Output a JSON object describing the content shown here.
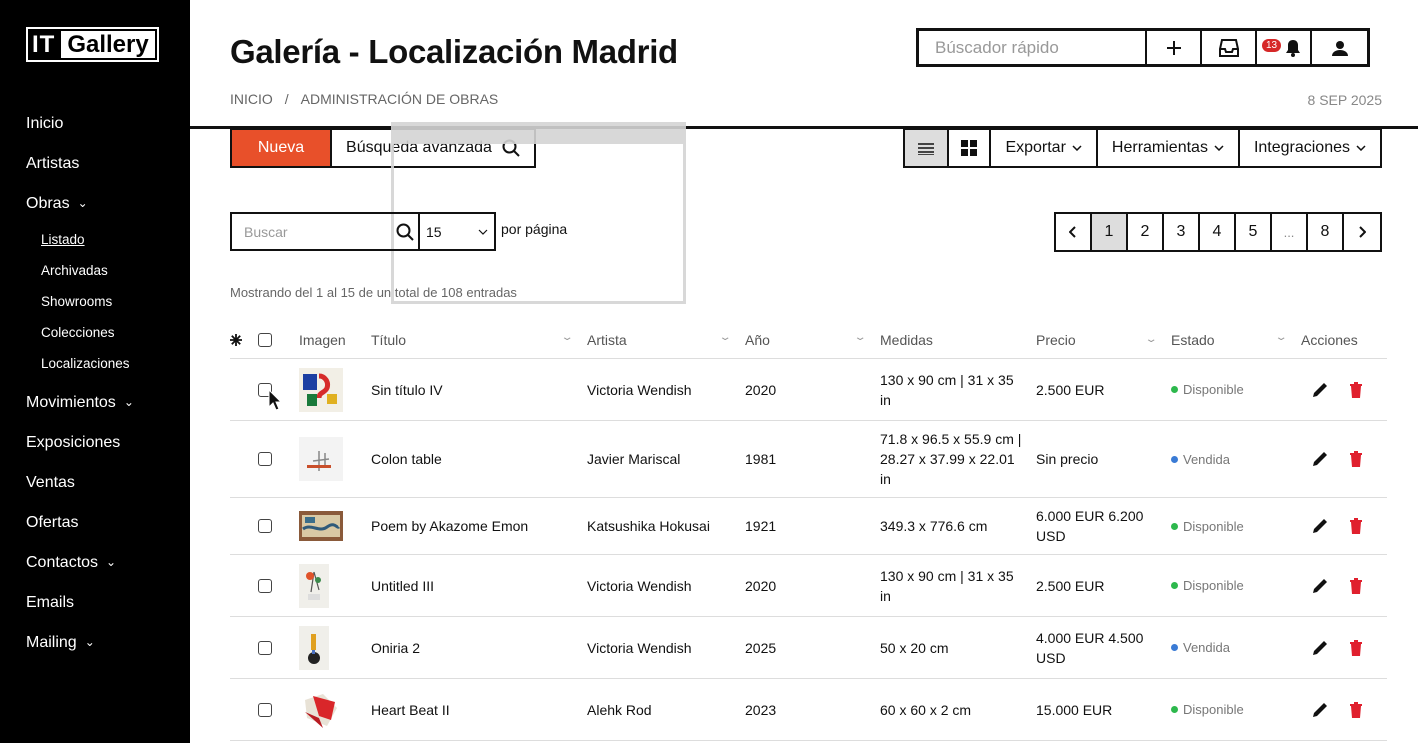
{
  "app": {
    "logo_it": "IT",
    "logo_gallery": "Gallery"
  },
  "sidebar": {
    "items": [
      {
        "label": "Inicio"
      },
      {
        "label": "Artistas"
      },
      {
        "label": "Obras",
        "expanded": true
      },
      {
        "label": "Movimientos"
      },
      {
        "label": "Exposiciones"
      },
      {
        "label": "Ventas"
      },
      {
        "label": "Ofertas"
      },
      {
        "label": "Contactos"
      },
      {
        "label": "Emails"
      },
      {
        "label": "Mailing"
      }
    ],
    "obras_sub": [
      "Listado",
      "Archivadas",
      "Showrooms",
      "Colecciones",
      "Localizaciones"
    ]
  },
  "header": {
    "title": "Galería - Localización Madrid",
    "breadcrumb": [
      "INICIO",
      "/",
      "ADMINISTRACIÓN DE OBRAS"
    ],
    "date": "8 SEP 2025",
    "search_placeholder": "Búscador rápido",
    "notification_count": "13"
  },
  "toolbar": {
    "new_label": "Nueva",
    "advanced_label": "Búsqueda avanzada",
    "export_label": "Exportar",
    "tools_label": "Herramientas",
    "integrations_label": "Integraciones"
  },
  "filters": {
    "search_placeholder": "Buscar",
    "per_page_value": "15",
    "per_page_label": "por página"
  },
  "pagination": [
    "1",
    "2",
    "3",
    "4",
    "5",
    "...",
    "8"
  ],
  "info": "Mostrando del 1 al 15 de un total de 108 entradas",
  "table": {
    "headers": {
      "image": "Imagen",
      "title": "Título",
      "artist": "Artista",
      "year": "Año",
      "size": "Medidas",
      "price": "Precio",
      "state": "Estado",
      "actions": "Acciones"
    },
    "rows": [
      {
        "title": "Sin título IV",
        "artist": "Victoria Wendish",
        "year": "2020",
        "size": "130 x 90 cm | 31 x 35 in",
        "price": "2.500 EUR",
        "state": "Disponible",
        "state_color": "#2db84d"
      },
      {
        "title": "Colon table",
        "artist": "Javier Mariscal",
        "year": "1981",
        "size": "71.8 x 96.5 x 55.9 cm | 28.27 x 37.99 x 22.01 in",
        "price": "Sin precio",
        "state": "Vendida",
        "state_color": "#3a7bd5"
      },
      {
        "title": "Poem by Akazome Emon",
        "artist": "Katsushika Hokusai",
        "year": "1921",
        "size": "349.3 x 776.6 cm",
        "price": "6.000 EUR 6.200 USD",
        "state": "Disponible",
        "state_color": "#2db84d"
      },
      {
        "title": "Untitled III",
        "artist": "Victoria Wendish",
        "year": "2020",
        "size": "130 x 90 cm | 31 x 35 in",
        "price": "2.500 EUR",
        "state": "Disponible",
        "state_color": "#2db84d"
      },
      {
        "title": "Oniria 2",
        "artist": "Victoria Wendish",
        "year": "2025",
        "size": "50 x 20 cm",
        "price": "4.000 EUR 4.500 USD",
        "state": "Vendida",
        "state_color": "#3a7bd5"
      },
      {
        "title": "Heart Beat II",
        "artist": "Alehk Rod",
        "year": "2023",
        "size": "60 x 60 x 2 cm",
        "price": "15.000 EUR",
        "state": "Disponible",
        "state_color": "#2db84d"
      }
    ]
  }
}
